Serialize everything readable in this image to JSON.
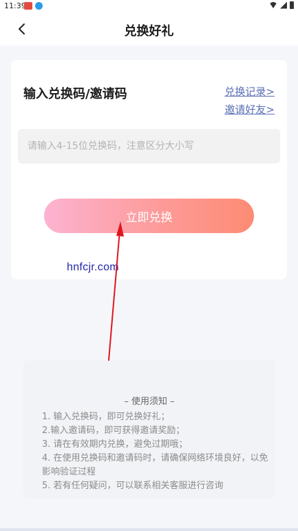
{
  "status_bar": {
    "time": "11:39"
  },
  "header": {
    "title": "兑换好礼"
  },
  "card": {
    "heading": "输入兑换码/邀请码",
    "link_records": "兑换记录>",
    "link_invite": "邀请好友>",
    "input_placeholder": "请输入4-15位兑换码，注意区分大小写",
    "input_value": "",
    "redeem_label": "立即兑换"
  },
  "watermark": "hnfcjr.com",
  "notice": {
    "title": "– 使用须知 –",
    "items": [
      "1. 输入兑换码，即可兑换好礼；",
      "2.输入邀请码，即可获得邀请奖励；",
      "3. 请在有效期内兑换，避免过期哦；",
      "4. 在使用兑换码和邀请码时，请确保网络环境良好，以免影响验证过程",
      "5. 若有任何疑问，可以联系相关客服进行咨询"
    ]
  },
  "colors": {
    "link": "#5a6fb6",
    "button_gradient_start": "#fcb3d1",
    "button_gradient_end": "#fd8b73",
    "annotation_arrow": "#e0161e"
  }
}
